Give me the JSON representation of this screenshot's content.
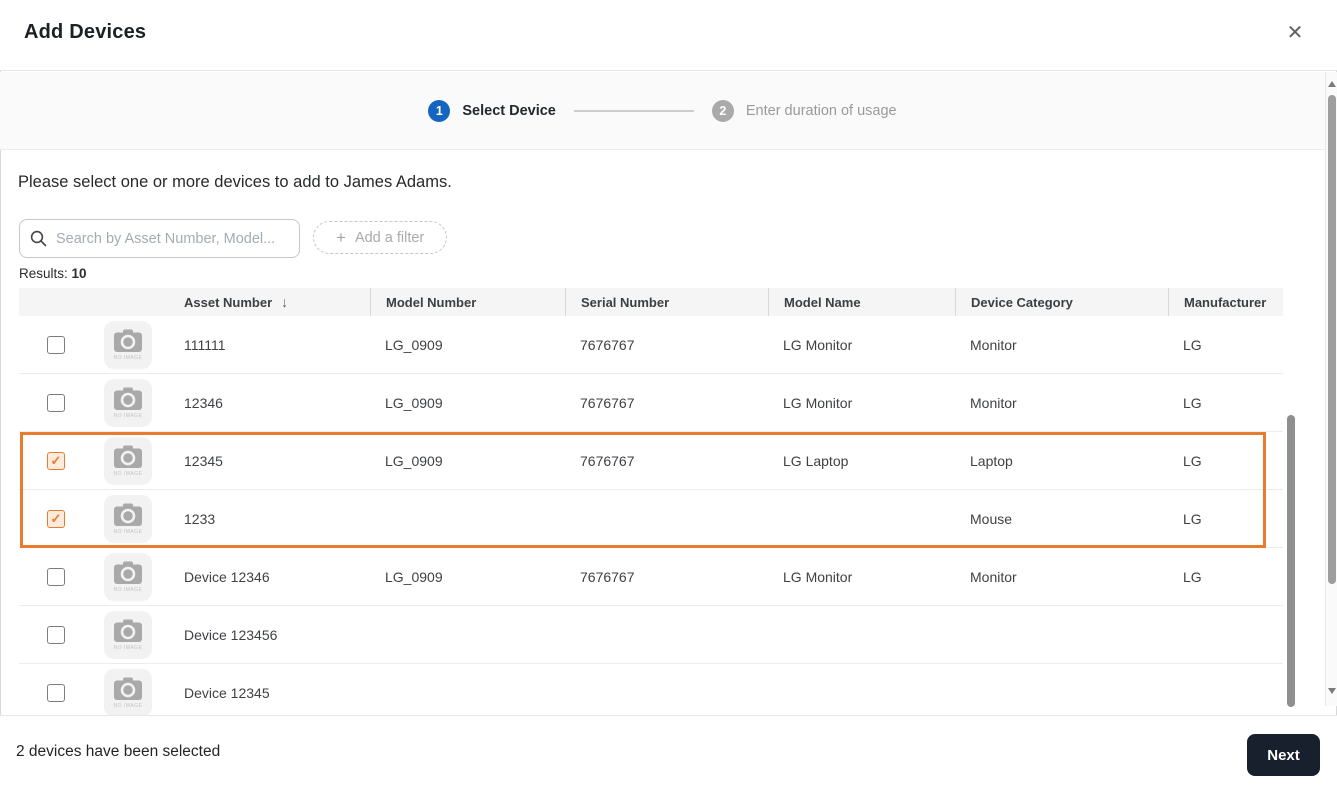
{
  "modal": {
    "title": "Add Devices",
    "close_icon": "✕"
  },
  "stepper": {
    "steps": [
      {
        "number": "1",
        "label": "Select Device",
        "state": "active"
      },
      {
        "number": "2",
        "label": "Enter duration of usage",
        "state": "inactive"
      }
    ]
  },
  "body": {
    "prompt": "Please select one or more devices to add to James Adams.",
    "search_placeholder": "Search by Asset Number, Model...",
    "add_filter_label": "Add a filter",
    "plus_icon": "+",
    "results_label": "Results:",
    "results_count": "10"
  },
  "table": {
    "columns": [
      "Asset Number",
      "Model Number",
      "Serial Number",
      "Model Name",
      "Device Category",
      "Manufacturer"
    ],
    "sort_column": "Asset Number",
    "sort_icon": "↓",
    "check_glyph": "✓",
    "no_image_label": "NO IMAGE",
    "selection_color": "#e87b2e",
    "rows": [
      {
        "checked": false,
        "selected": false,
        "asset_number": "111111",
        "model_number": "LG_0909",
        "serial_number": "7676767",
        "model_name": "LG Monitor",
        "device_category": "Monitor",
        "manufacturer": "LG"
      },
      {
        "checked": false,
        "selected": false,
        "asset_number": "12346",
        "model_number": "LG_0909",
        "serial_number": "7676767",
        "model_name": "LG Monitor",
        "device_category": "Monitor",
        "manufacturer": "LG"
      },
      {
        "checked": true,
        "selected": true,
        "asset_number": "12345",
        "model_number": "LG_0909",
        "serial_number": "7676767",
        "model_name": "LG Laptop",
        "device_category": "Laptop",
        "manufacturer": "LG"
      },
      {
        "checked": true,
        "selected": true,
        "asset_number": "1233",
        "model_number": "",
        "serial_number": "",
        "model_name": "",
        "device_category": "Mouse",
        "manufacturer": "LG"
      },
      {
        "checked": false,
        "selected": false,
        "asset_number": "Device 12346",
        "model_number": "LG_0909",
        "serial_number": "7676767",
        "model_name": "LG Monitor",
        "device_category": "Monitor",
        "manufacturer": "LG"
      },
      {
        "checked": false,
        "selected": false,
        "asset_number": "Device 123456",
        "model_number": "",
        "serial_number": "",
        "model_name": "",
        "device_category": "",
        "manufacturer": ""
      },
      {
        "checked": false,
        "selected": false,
        "asset_number": "Device 12345",
        "model_number": "",
        "serial_number": "",
        "model_name": "",
        "device_category": "",
        "manufacturer": ""
      }
    ]
  },
  "footer": {
    "selection_summary": "2 devices have been selected",
    "next_label": "Next"
  },
  "colors": {
    "accent_selection": "#e87b2e",
    "step_active": "#1565c0",
    "step_inactive": "#aaaaaa",
    "next_button": "#18202e"
  }
}
